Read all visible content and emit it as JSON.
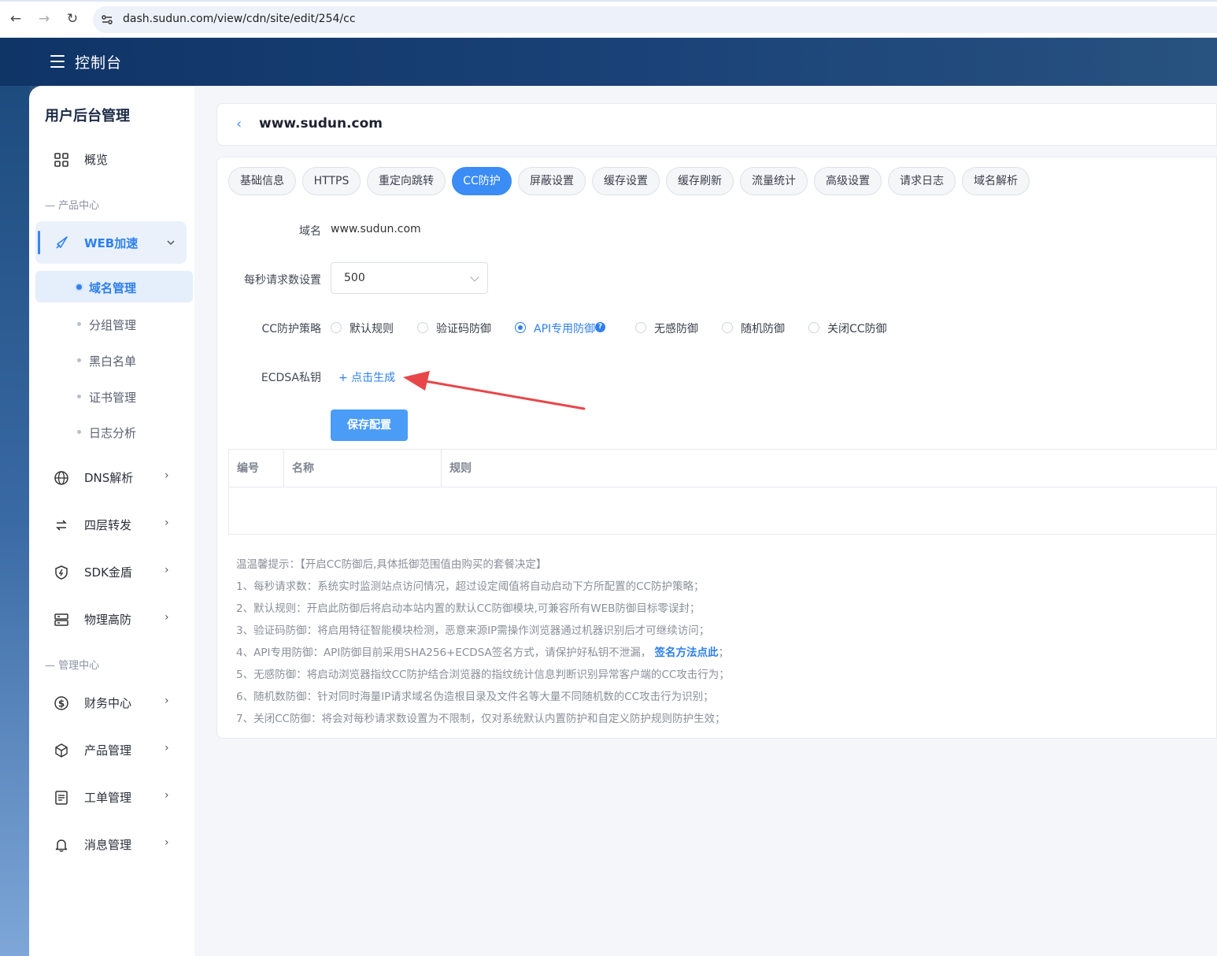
{
  "browser": {
    "url": "dash.sudun.com/view/cdn/site/edit/254/cc"
  },
  "header": {
    "title": "控制台"
  },
  "sidebar": {
    "title": "用户后台管理",
    "overview": "概览",
    "section_product": "— 产品中心",
    "web_accel": "WEB加速",
    "sub_items": [
      "域名管理",
      "分组管理",
      "黑白名单",
      "证书管理",
      "日志分析"
    ],
    "items": [
      "DNS解析",
      "四层转发",
      "SDK金盾",
      "物理高防"
    ],
    "section_manage": "— 管理中心",
    "manage_items": [
      "财务中心",
      "产品管理",
      "工单管理",
      "消息管理"
    ]
  },
  "main": {
    "domain": "www.sudun.com",
    "tabs": [
      "基础信息",
      "HTTPS",
      "重定向跳转",
      "CC防护",
      "屏蔽设置",
      "缓存设置",
      "缓存刷新",
      "流量统计",
      "高级设置",
      "请求日志",
      "域名解析"
    ],
    "active_tab": "CC防护",
    "form": {
      "domain_label": "域名",
      "domain_value": "www.sudun.com",
      "rps_label": "每秒请求数设置",
      "rps_value": "500",
      "strategy_label": "CC防护策略",
      "strategies": [
        "默认规则",
        "验证码防御",
        "API专用防御",
        "无感防御",
        "随机防御",
        "关闭CC防御"
      ],
      "selected_strategy": "API专用防御",
      "ecdsa_label": "ECDSA私钥",
      "generate_link": "+ 点击生成",
      "save_button": "保存配置"
    },
    "table": {
      "columns": [
        "编号",
        "名称",
        "规则"
      ]
    },
    "tips": {
      "title": "温温馨提示：【开启CC防御后,具体抵御范围值由购买的套餐决定】",
      "lines": [
        "1、每秒请求数：系统实时监测站点访问情况，超过设定阈值将自动启动下方所配置的CC防护策略；",
        "2、默认规则：开启此防御后将启动本站内置的默认CC防御模块,可兼容所有WEB防御目标零误封；",
        "3、验证码防御：将启用特征智能模块检测，恶意来源IP需操作浏览器通过机器识别后才可继续访问；",
        "4、API专用防御：API防御目前采用SHA256+ECDSA签名方式，请保护好私钥不泄漏，",
        "5、无感防御：将启动浏览器指纹CC防护结合浏览器的指纹统计信息判断识别异常客户端的CC攻击行为；",
        "6、随机数防御：针对同时海量IP请求域名伪造根目录及文件名等大量不同随机数的CC攻击行为识别；",
        "7、关闭CC防御：将会对每秒请求数设置为不限制，仅对系统默认内置防护和自定义防护规则防护生效；"
      ],
      "line4_link": "签名方法点此",
      "line4_tail": "；"
    }
  },
  "colors": {
    "accent": "#2f80ed",
    "header_bg": "#0f3466",
    "annotation_arrow": "#e8474a"
  }
}
